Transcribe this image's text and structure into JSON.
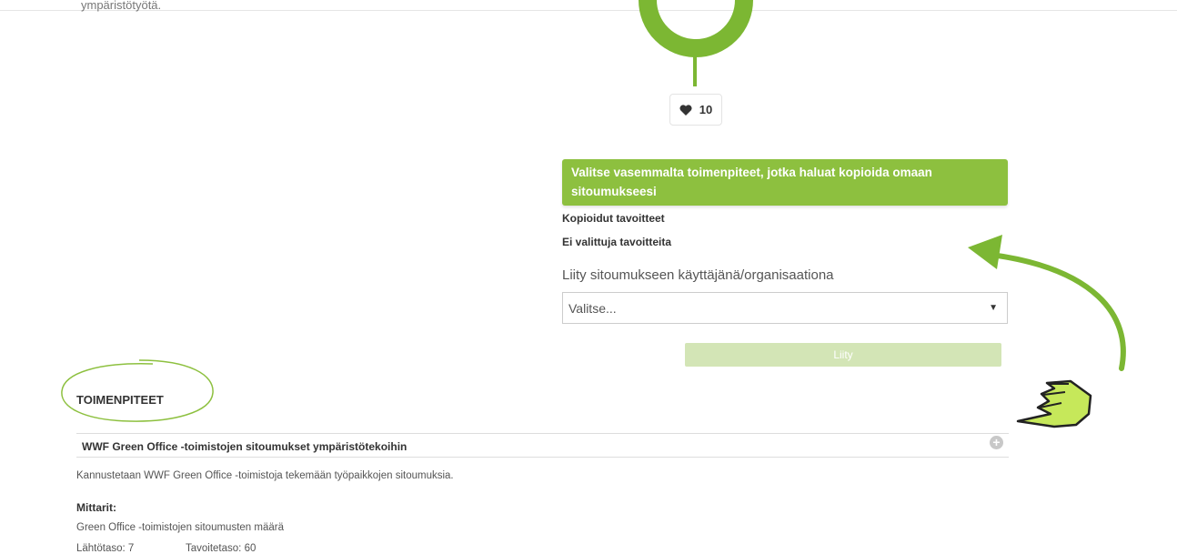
{
  "intro": {
    "cut_text": "ympäristötyötä."
  },
  "likes": {
    "icon": "heart-icon",
    "count": "10"
  },
  "copy_panel": {
    "banner": "Valitse vasemmalta toimenpiteet, jotka haluat kopioida omaan sitoumukseesi",
    "copied_label": "Kopioidut tavoitteet",
    "none_label": "Ei valittuja tavoitteita"
  },
  "join": {
    "title": "Liity sitoumukseen käyttäjänä/organisaationa",
    "select_value": "Valitse...",
    "button": "Liity"
  },
  "actions": {
    "title": "TOIMENPITEET",
    "item_title": "WWF Green Office -toimistojen sitoumukset ympäristötekoihin",
    "item_description": "Kannustetaan WWF Green Office -toimistoja tekemään työpaikkojen sitoumuksia.",
    "metrics_label": "Mittarit:",
    "metric_name": "Green Office -toimistojen sitoumusten määrä",
    "baseline": "Lähtötaso: 7",
    "target": "Tavoitetaso: 60"
  },
  "colors": {
    "accent_green": "#8dc03f",
    "button_disabled": "#d3e5b6"
  }
}
